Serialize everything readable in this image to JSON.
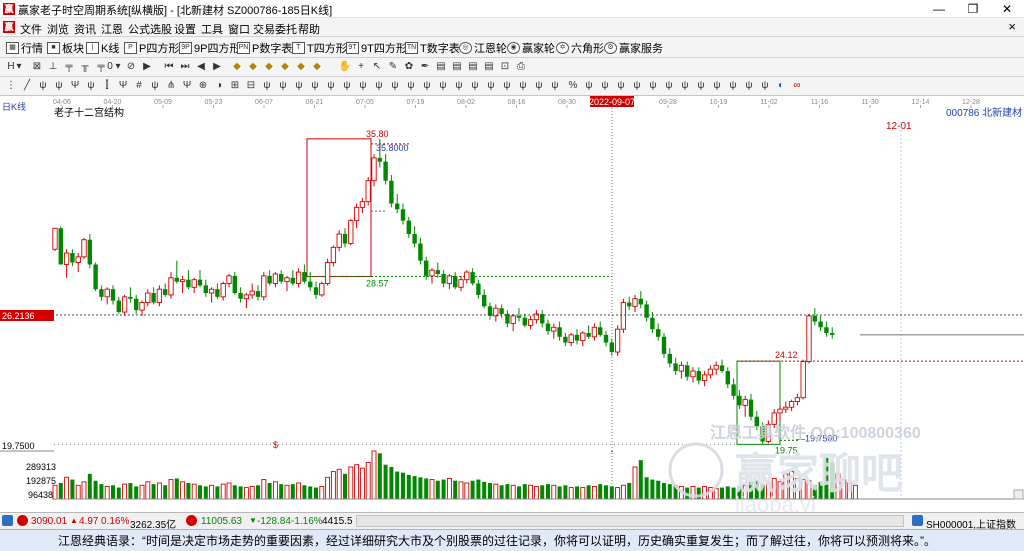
{
  "window": {
    "title": "赢家老子时空周期系统[纵横版] - [北新建材  SZ000786-185日K线]",
    "minimize": "—",
    "maximize": "❐",
    "close": "✕",
    "app_icon": "赢"
  },
  "menu": [
    "文件",
    "浏览",
    "资讯",
    "江恩",
    "公式选股",
    "设置",
    "工具",
    "窗口",
    "交易委托",
    "帮助"
  ],
  "menu_close": "×",
  "toolbar1": [
    {
      "label": "行情",
      "icon": "grid-icon"
    },
    {
      "label": "板块",
      "icon": "blocks-icon"
    },
    {
      "label": "K线",
      "icon": "kline-icon"
    },
    {
      "label": "P四方形",
      "icon": "P4"
    },
    {
      "label": "9P四方形",
      "icon": "9P"
    },
    {
      "label": "P数字表",
      "icon": "PN"
    },
    {
      "label": "T四方形",
      "icon": "T4"
    },
    {
      "label": "9T四方形",
      "icon": "9T"
    },
    {
      "label": "T数字表",
      "icon": "TN"
    },
    {
      "label": "江恩轮",
      "icon": "wheel-icon"
    },
    {
      "label": "赢家轮",
      "icon": "wheel2-icon"
    },
    {
      "label": "六角形",
      "icon": "hexagon-icon"
    },
    {
      "label": "赢家服务",
      "icon": "service-icon"
    }
  ],
  "toolbar2_counter": "0",
  "chart_data": {
    "type": "candlestick",
    "period_label": "日K线",
    "title": "老子十二宫结构",
    "stock_label": "000786  北新建材",
    "date_ticks": [
      "04-06",
      "04-20",
      "05-09",
      "05-23",
      "06-07",
      "06-21",
      "07-05",
      "07-19",
      "08-02",
      "08-16",
      "08-30",
      "09-07",
      "09-28",
      "10-19",
      "11-02",
      "11-16",
      "11-30",
      "12-14",
      "12-28"
    ],
    "cursor_date": "2022-09-07",
    "future_marker": "12-01",
    "current_price": "26.2136",
    "price_axis": [
      {
        "label": "19.7500",
        "value": 19.75
      }
    ],
    "volume_axis": [
      "289313",
      "192875",
      "96438"
    ],
    "price_range": [
      19.4,
      37.0
    ],
    "annotations": {
      "high_box_top": "35.80",
      "high_box_label": "35.8000",
      "high_box_low": "28.57",
      "low_box_high": "24.12",
      "low_box_label": "19.7500",
      "low_box_bottom": "19.75",
      "dollar_marker": "$"
    },
    "watermark_lines": [
      "江恩工具软件  QQ:100800360",
      "赢家聊吧",
      "liaoba.yj"
    ],
    "candles": [
      {
        "o": 30.0,
        "h": 31.1,
        "l": 29.9,
        "c": 31.1
      },
      {
        "o": 31.1,
        "h": 31.2,
        "l": 29.2,
        "c": 29.2
      },
      {
        "o": 29.2,
        "h": 30.0,
        "l": 28.5,
        "c": 29.8
      },
      {
        "o": 29.8,
        "h": 30.0,
        "l": 29.1,
        "c": 29.3
      },
      {
        "o": 29.3,
        "h": 29.8,
        "l": 28.8,
        "c": 29.6
      },
      {
        "o": 29.6,
        "h": 30.6,
        "l": 29.5,
        "c": 30.5
      },
      {
        "o": 30.5,
        "h": 30.8,
        "l": 29.0,
        "c": 29.2
      },
      {
        "o": 29.2,
        "h": 29.3,
        "l": 27.8,
        "c": 27.9
      },
      {
        "o": 27.9,
        "h": 28.1,
        "l": 27.3,
        "c": 27.5
      },
      {
        "o": 27.5,
        "h": 28.0,
        "l": 27.1,
        "c": 27.9
      },
      {
        "o": 27.9,
        "h": 28.1,
        "l": 27.1,
        "c": 27.3
      },
      {
        "o": 27.3,
        "h": 27.5,
        "l": 26.6,
        "c": 26.7
      },
      {
        "o": 26.7,
        "h": 27.6,
        "l": 26.5,
        "c": 27.5
      },
      {
        "o": 27.5,
        "h": 28.0,
        "l": 27.2,
        "c": 27.4
      },
      {
        "o": 27.4,
        "h": 27.6,
        "l": 26.6,
        "c": 26.8
      },
      {
        "o": 26.8,
        "h": 27.3,
        "l": 26.5,
        "c": 27.2
      },
      {
        "o": 27.2,
        "h": 27.9,
        "l": 27.0,
        "c": 27.7
      },
      {
        "o": 27.7,
        "h": 28.0,
        "l": 27.1,
        "c": 27.2
      },
      {
        "o": 27.2,
        "h": 28.1,
        "l": 27.0,
        "c": 27.9
      },
      {
        "o": 27.9,
        "h": 28.2,
        "l": 27.5,
        "c": 27.6
      },
      {
        "o": 27.6,
        "h": 28.8,
        "l": 27.4,
        "c": 28.5
      },
      {
        "o": 28.5,
        "h": 29.4,
        "l": 28.2,
        "c": 28.3
      },
      {
        "o": 28.3,
        "h": 28.6,
        "l": 27.7,
        "c": 28.4
      },
      {
        "o": 28.4,
        "h": 28.9,
        "l": 27.9,
        "c": 28.0
      },
      {
        "o": 28.0,
        "h": 28.5,
        "l": 27.7,
        "c": 28.4
      },
      {
        "o": 28.4,
        "h": 28.9,
        "l": 28.0,
        "c": 28.1
      },
      {
        "o": 28.1,
        "h": 28.4,
        "l": 27.5,
        "c": 27.7
      },
      {
        "o": 27.7,
        "h": 28.0,
        "l": 27.2,
        "c": 27.9
      },
      {
        "o": 27.9,
        "h": 28.2,
        "l": 27.4,
        "c": 27.5
      },
      {
        "o": 27.5,
        "h": 28.3,
        "l": 27.3,
        "c": 28.2
      },
      {
        "o": 28.2,
        "h": 28.7,
        "l": 28.0,
        "c": 28.6
      },
      {
        "o": 28.6,
        "h": 28.8,
        "l": 27.6,
        "c": 27.7
      },
      {
        "o": 27.7,
        "h": 28.0,
        "l": 27.2,
        "c": 27.4
      },
      {
        "o": 27.4,
        "h": 27.7,
        "l": 26.9,
        "c": 27.6
      },
      {
        "o": 27.6,
        "h": 28.2,
        "l": 27.4,
        "c": 27.8
      },
      {
        "o": 27.8,
        "h": 28.1,
        "l": 27.3,
        "c": 27.5
      },
      {
        "o": 27.5,
        "h": 28.8,
        "l": 27.3,
        "c": 28.6
      },
      {
        "o": 28.6,
        "h": 28.9,
        "l": 28.1,
        "c": 28.2
      },
      {
        "o": 28.2,
        "h": 28.8,
        "l": 28.0,
        "c": 28.7
      },
      {
        "o": 28.7,
        "h": 28.9,
        "l": 28.2,
        "c": 28.3
      },
      {
        "o": 28.3,
        "h": 28.6,
        "l": 27.8,
        "c": 28.5
      },
      {
        "o": 28.5,
        "h": 28.9,
        "l": 28.1,
        "c": 28.2
      },
      {
        "o": 28.2,
        "h": 29.0,
        "l": 28.0,
        "c": 28.8
      },
      {
        "o": 28.8,
        "h": 29.2,
        "l": 28.2,
        "c": 28.3
      },
      {
        "o": 28.3,
        "h": 28.8,
        "l": 27.8,
        "c": 28.0
      },
      {
        "o": 28.0,
        "h": 28.3,
        "l": 27.4,
        "c": 27.6
      },
      {
        "o": 27.6,
        "h": 28.3,
        "l": 27.5,
        "c": 28.2
      },
      {
        "o": 28.2,
        "h": 29.5,
        "l": 28.1,
        "c": 29.3
      },
      {
        "o": 29.3,
        "h": 30.2,
        "l": 29.1,
        "c": 30.1
      },
      {
        "o": 30.1,
        "h": 31.0,
        "l": 29.9,
        "c": 30.8
      },
      {
        "o": 30.8,
        "h": 31.1,
        "l": 30.1,
        "c": 30.3
      },
      {
        "o": 30.3,
        "h": 31.6,
        "l": 30.2,
        "c": 31.5
      },
      {
        "o": 31.5,
        "h": 32.4,
        "l": 31.1,
        "c": 32.2
      },
      {
        "o": 32.2,
        "h": 32.7,
        "l": 31.9,
        "c": 32.5
      },
      {
        "o": 32.5,
        "h": 33.8,
        "l": 32.3,
        "c": 33.6
      },
      {
        "o": 33.6,
        "h": 35.0,
        "l": 33.3,
        "c": 34.8
      },
      {
        "o": 34.8,
        "h": 35.8,
        "l": 34.3,
        "c": 34.6
      },
      {
        "o": 34.6,
        "h": 35.0,
        "l": 33.4,
        "c": 33.6
      },
      {
        "o": 33.6,
        "h": 33.9,
        "l": 32.2,
        "c": 32.4
      },
      {
        "o": 32.4,
        "h": 32.9,
        "l": 31.9,
        "c": 32.1
      },
      {
        "o": 32.1,
        "h": 32.4,
        "l": 31.3,
        "c": 31.5
      },
      {
        "o": 31.5,
        "h": 31.7,
        "l": 30.6,
        "c": 30.8
      },
      {
        "o": 30.8,
        "h": 31.2,
        "l": 30.1,
        "c": 30.3
      },
      {
        "o": 30.3,
        "h": 30.6,
        "l": 29.2,
        "c": 29.4
      },
      {
        "o": 29.4,
        "h": 29.6,
        "l": 28.4,
        "c": 28.6
      },
      {
        "o": 28.6,
        "h": 29.0,
        "l": 28.2,
        "c": 28.9
      },
      {
        "o": 28.9,
        "h": 29.3,
        "l": 28.5,
        "c": 28.7
      },
      {
        "o": 28.7,
        "h": 28.9,
        "l": 28.0,
        "c": 28.2
      },
      {
        "o": 28.2,
        "h": 28.7,
        "l": 27.9,
        "c": 28.6
      },
      {
        "o": 28.6,
        "h": 28.8,
        "l": 27.9,
        "c": 28.0
      },
      {
        "o": 28.0,
        "h": 28.6,
        "l": 27.8,
        "c": 28.4
      },
      {
        "o": 28.4,
        "h": 28.9,
        "l": 28.2,
        "c": 28.8
      },
      {
        "o": 28.8,
        "h": 29.0,
        "l": 28.1,
        "c": 28.2
      },
      {
        "o": 28.2,
        "h": 28.4,
        "l": 27.4,
        "c": 27.6
      },
      {
        "o": 27.6,
        "h": 27.9,
        "l": 26.9,
        "c": 27.0
      },
      {
        "o": 27.0,
        "h": 27.2,
        "l": 26.3,
        "c": 26.5
      },
      {
        "o": 26.5,
        "h": 27.1,
        "l": 26.2,
        "c": 26.9
      },
      {
        "o": 26.9,
        "h": 27.1,
        "l": 26.4,
        "c": 26.6
      },
      {
        "o": 26.6,
        "h": 26.8,
        "l": 25.9,
        "c": 26.1
      },
      {
        "o": 26.1,
        "h": 26.6,
        "l": 25.7,
        "c": 26.5
      },
      {
        "o": 26.5,
        "h": 26.9,
        "l": 26.2,
        "c": 26.4
      },
      {
        "o": 26.4,
        "h": 26.6,
        "l": 25.9,
        "c": 26.0
      },
      {
        "o": 26.0,
        "h": 26.5,
        "l": 25.8,
        "c": 26.3
      },
      {
        "o": 26.3,
        "h": 26.8,
        "l": 26.1,
        "c": 26.6
      },
      {
        "o": 26.6,
        "h": 26.8,
        "l": 25.9,
        "c": 26.1
      },
      {
        "o": 26.1,
        "h": 26.3,
        "l": 25.5,
        "c": 25.7
      },
      {
        "o": 25.7,
        "h": 26.1,
        "l": 25.3,
        "c": 25.9
      },
      {
        "o": 25.9,
        "h": 26.2,
        "l": 25.2,
        "c": 25.4
      },
      {
        "o": 25.4,
        "h": 25.6,
        "l": 24.9,
        "c": 25.1
      },
      {
        "o": 25.1,
        "h": 25.6,
        "l": 24.9,
        "c": 25.5
      },
      {
        "o": 25.5,
        "h": 25.8,
        "l": 25.0,
        "c": 25.2
      },
      {
        "o": 25.2,
        "h": 25.7,
        "l": 24.9,
        "c": 25.6
      },
      {
        "o": 25.6,
        "h": 26.0,
        "l": 25.3,
        "c": 25.4
      },
      {
        "o": 25.4,
        "h": 26.1,
        "l": 25.2,
        "c": 25.9
      },
      {
        "o": 25.9,
        "h": 26.2,
        "l": 25.4,
        "c": 25.5
      },
      {
        "o": 25.5,
        "h": 25.7,
        "l": 24.9,
        "c": 25.1
      },
      {
        "o": 25.1,
        "h": 25.3,
        "l": 24.4,
        "c": 24.6
      },
      {
        "o": 24.6,
        "h": 26.0,
        "l": 24.4,
        "c": 25.8
      },
      {
        "o": 25.8,
        "h": 27.4,
        "l": 25.6,
        "c": 27.2
      },
      {
        "o": 27.2,
        "h": 27.5,
        "l": 26.8,
        "c": 27.0
      },
      {
        "o": 27.0,
        "h": 27.6,
        "l": 26.7,
        "c": 27.4
      },
      {
        "o": 27.4,
        "h": 27.8,
        "l": 26.9,
        "c": 27.1
      },
      {
        "o": 27.1,
        "h": 27.3,
        "l": 26.2,
        "c": 26.4
      },
      {
        "o": 26.4,
        "h": 26.7,
        "l": 25.6,
        "c": 25.8
      },
      {
        "o": 25.8,
        "h": 26.1,
        "l": 25.2,
        "c": 25.4
      },
      {
        "o": 25.4,
        "h": 25.6,
        "l": 24.3,
        "c": 24.5
      },
      {
        "o": 24.5,
        "h": 24.8,
        "l": 23.8,
        "c": 24.0
      },
      {
        "o": 24.0,
        "h": 24.3,
        "l": 23.4,
        "c": 23.6
      },
      {
        "o": 23.6,
        "h": 24.1,
        "l": 23.2,
        "c": 23.9
      },
      {
        "o": 23.9,
        "h": 24.1,
        "l": 23.1,
        "c": 23.3
      },
      {
        "o": 23.3,
        "h": 23.8,
        "l": 23.0,
        "c": 23.6
      },
      {
        "o": 23.6,
        "h": 23.8,
        "l": 22.9,
        "c": 23.1
      },
      {
        "o": 23.1,
        "h": 23.6,
        "l": 22.8,
        "c": 23.4
      },
      {
        "o": 23.4,
        "h": 23.9,
        "l": 23.2,
        "c": 23.7
      },
      {
        "o": 23.7,
        "h": 24.1,
        "l": 23.4,
        "c": 23.9
      },
      {
        "o": 23.9,
        "h": 24.2,
        "l": 23.5,
        "c": 23.6
      },
      {
        "o": 23.6,
        "h": 23.8,
        "l": 22.7,
        "c": 22.9
      },
      {
        "o": 22.9,
        "h": 23.2,
        "l": 22.1,
        "c": 22.3
      },
      {
        "o": 22.3,
        "h": 22.6,
        "l": 21.6,
        "c": 21.8
      },
      {
        "o": 21.8,
        "h": 22.3,
        "l": 21.2,
        "c": 22.1
      },
      {
        "o": 22.1,
        "h": 22.4,
        "l": 21.0,
        "c": 21.2
      },
      {
        "o": 21.2,
        "h": 21.5,
        "l": 20.5,
        "c": 20.7
      },
      {
        "o": 20.7,
        "h": 20.9,
        "l": 19.75,
        "c": 19.9
      },
      {
        "o": 19.9,
        "h": 21.0,
        "l": 19.8,
        "c": 20.8
      },
      {
        "o": 20.8,
        "h": 21.6,
        "l": 20.6,
        "c": 21.4
      },
      {
        "o": 21.4,
        "h": 21.8,
        "l": 21.0,
        "c": 21.6
      },
      {
        "o": 21.6,
        "h": 22.0,
        "l": 21.4,
        "c": 21.7
      },
      {
        "o": 21.7,
        "h": 22.1,
        "l": 21.5,
        "c": 22.0
      },
      {
        "o": 22.0,
        "h": 22.4,
        "l": 21.8,
        "c": 22.2
      },
      {
        "o": 22.2,
        "h": 24.2,
        "l": 22.1,
        "c": 24.1
      },
      {
        "o": 24.1,
        "h": 26.6,
        "l": 24.0,
        "c": 26.5
      },
      {
        "o": 26.5,
        "h": 26.9,
        "l": 26.0,
        "c": 26.2
      },
      {
        "o": 26.2,
        "h": 26.5,
        "l": 25.7,
        "c": 25.9
      },
      {
        "o": 25.9,
        "h": 26.2,
        "l": 25.4,
        "c": 25.6
      },
      {
        "o": 25.6,
        "h": 25.9,
        "l": 25.3,
        "c": 25.5
      }
    ],
    "volumes": [
      60,
      70,
      95,
      85,
      60,
      75,
      110,
      80,
      65,
      55,
      60,
      50,
      65,
      70,
      55,
      60,
      75,
      65,
      70,
      60,
      85,
      90,
      75,
      70,
      65,
      60,
      55,
      60,
      55,
      65,
      70,
      60,
      55,
      50,
      55,
      60,
      85,
      70,
      75,
      65,
      60,
      65,
      70,
      60,
      55,
      50,
      55,
      95,
      120,
      130,
      110,
      140,
      150,
      135,
      160,
      210,
      200,
      150,
      140,
      120,
      115,
      105,
      100,
      95,
      90,
      85,
      80,
      85,
      90,
      80,
      75,
      70,
      80,
      85,
      75,
      70,
      65,
      60,
      65,
      60,
      55,
      65,
      60,
      55,
      60,
      65,
      60,
      55,
      60,
      50,
      55,
      50,
      60,
      55,
      65,
      60,
      55,
      50,
      60,
      70,
      140,
      170,
      95,
      85,
      80,
      70,
      65,
      60,
      55,
      50,
      55,
      50,
      55,
      50,
      45,
      50,
      55,
      50,
      55,
      60,
      75,
      80,
      65,
      70,
      90,
      75,
      110,
      120,
      90,
      85,
      80,
      60,
      75,
      180,
      160,
      110,
      85,
      70,
      60
    ],
    "volume_max": 385000
  },
  "status": {
    "sh_index": "3090.01",
    "sh_change": "4.97",
    "sh_pct": "0.16%",
    "sh_amount": "3262.35亿",
    "sz_index": "11005.63",
    "sz_change": "-128.84",
    "sz_pct": "-1.16%",
    "sz_amount": "4415.5",
    "right": "SH000001,上证指数"
  },
  "quote": "江恩经典语录：“时间是决定市场走势的重要因素，经过详细研究大市及个别股票的过往记录，你将可以证明，历史确实重复发生；而了解过往，你将可以预测将来。”。"
}
